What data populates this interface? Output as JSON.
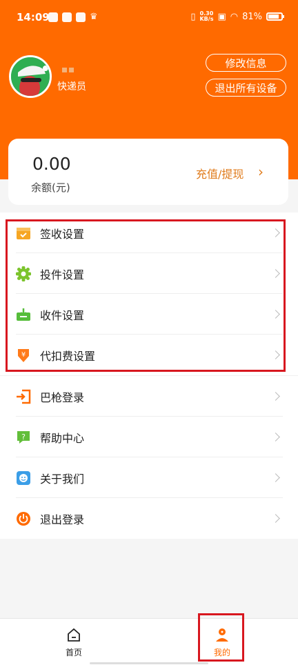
{
  "status_bar": {
    "time": "14:09",
    "net_speed_value": "0.30",
    "net_speed_unit": "KB/s",
    "battery": "81%",
    "battery_level": 0.81
  },
  "profile": {
    "role": "快递员",
    "edit_button": "修改信息",
    "logout_all_button": "退出所有设备"
  },
  "balance": {
    "amount": "0.00",
    "label": "余额(元)",
    "action": "充值/提现",
    "chevron": "›"
  },
  "menu": {
    "items": [
      {
        "label": "签收设置",
        "icon": "package-sign-icon",
        "color": "#f6a623"
      },
      {
        "label": "投件设置",
        "icon": "gear-icon",
        "color": "#7cc42c"
      },
      {
        "label": "收件设置",
        "icon": "inbox-download-icon",
        "color": "#56bd3b"
      },
      {
        "label": "代扣费设置",
        "icon": "yuan-fee-icon",
        "color": "#ff7a1a"
      },
      {
        "label": "巴枪登录",
        "icon": "login-arrow-icon",
        "color": "#ff6a00"
      },
      {
        "label": "帮助中心",
        "icon": "help-question-icon",
        "color": "#62be3a"
      },
      {
        "label": "关于我们",
        "icon": "smiley-icon",
        "color": "#3b9ee7"
      },
      {
        "label": "退出登录",
        "icon": "power-icon",
        "color": "#ff6a00"
      }
    ]
  },
  "bottom_nav": {
    "home_label": "首页",
    "mine_label": "我的",
    "active_color": "#ff6a00"
  },
  "colors": {
    "brand": "#ff6a00",
    "highlight": "#d8171f"
  }
}
